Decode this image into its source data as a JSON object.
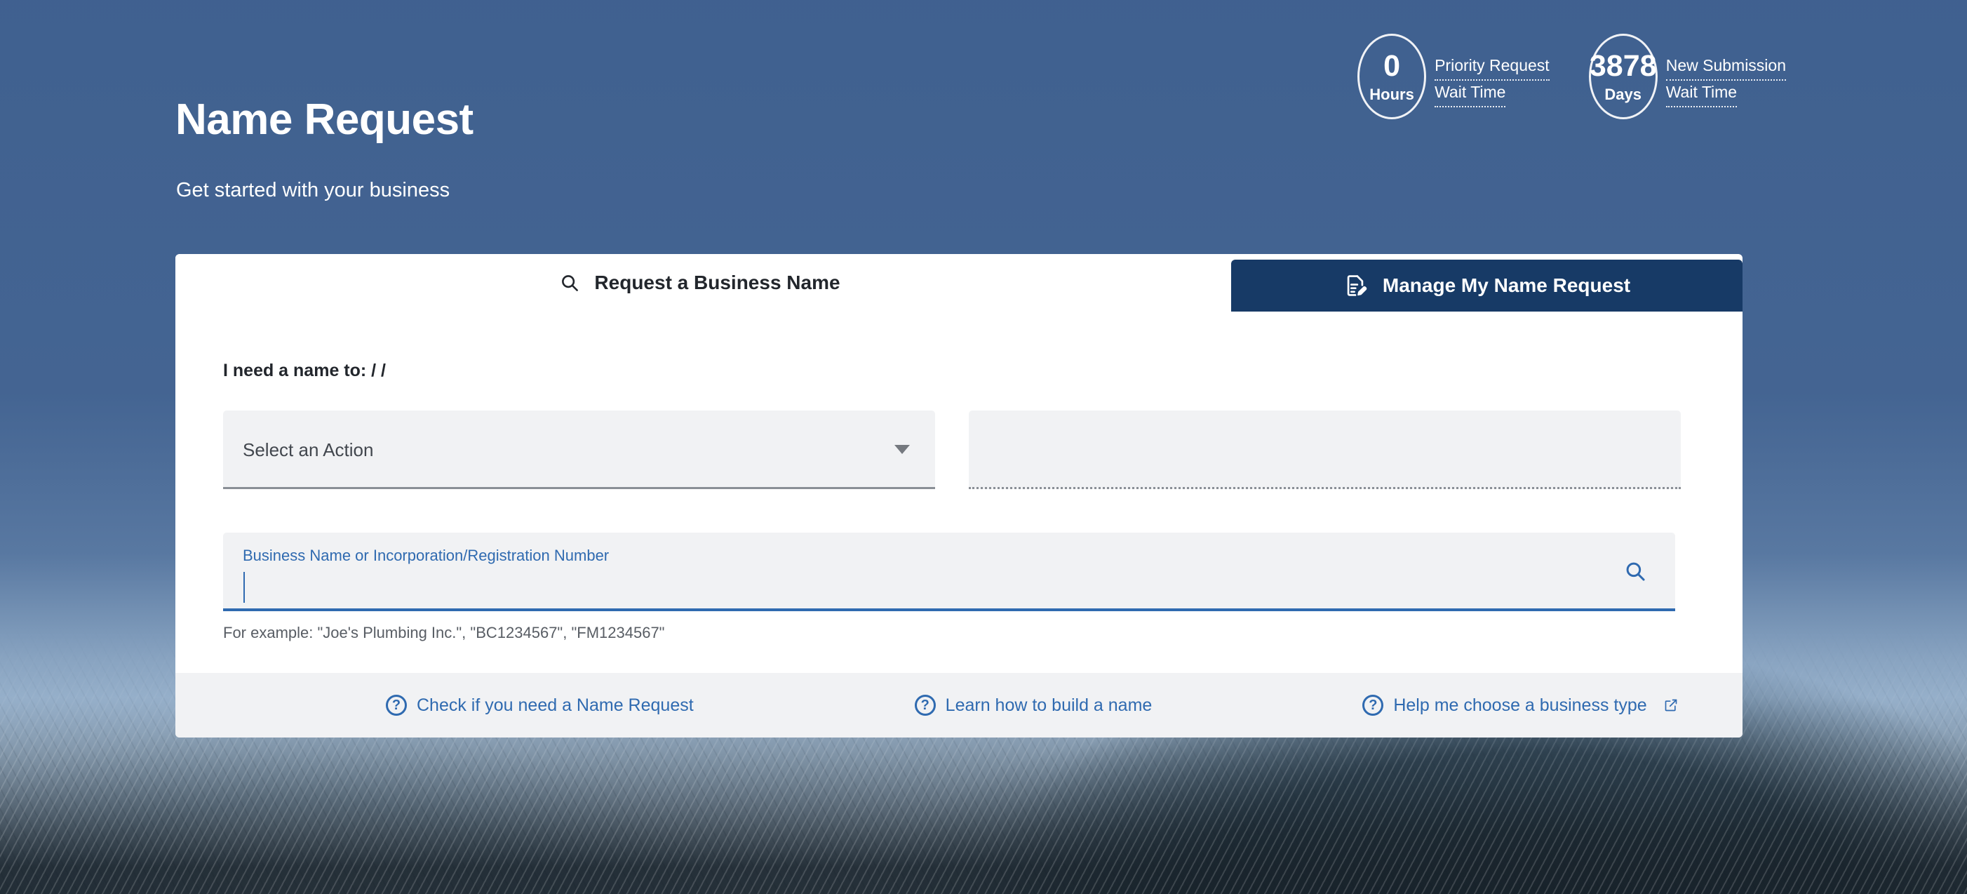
{
  "header": {
    "title": "Name Request",
    "subtitle": "Get started with your business"
  },
  "stats": [
    {
      "value": "0",
      "unit": "Hours",
      "label_line1": "Priority Request",
      "label_line2": "Wait Time",
      "icon": "oval-badge-icon"
    },
    {
      "value": "3878",
      "unit": "Days",
      "label_line1": "New Submission",
      "label_line2": "Wait Time",
      "icon": "oval-badge-icon"
    }
  ],
  "tabs": [
    {
      "label": "Request a Business Name",
      "icon": "search-icon",
      "active": true
    },
    {
      "label": "Manage My Name Request",
      "icon": "document-edit-icon",
      "active": false
    }
  ],
  "form": {
    "need_label": "I need a name to: / /",
    "action_select": {
      "value": "Select an Action",
      "caret": "chevron-down-icon"
    },
    "entity_select": {
      "value": ""
    },
    "search": {
      "float_label": "Business Name or Incorporation/Registration Number",
      "value": "",
      "placeholder": "",
      "icon": "search-icon",
      "hint": "For example: \"Joe's Plumbing Inc.\", \"BC1234567\", \"FM1234567\""
    }
  },
  "footer_links": [
    {
      "label": "Check if you need a Name Request",
      "icon": "question-circle-icon",
      "external": false
    },
    {
      "label": "Learn how to build a name",
      "icon": "question-circle-icon",
      "external": false
    },
    {
      "label": "Help me choose a business type",
      "icon": "question-circle-icon",
      "external": true
    }
  ],
  "colors": {
    "brand_navy": "#173a66",
    "brand_blue": "#2f6ab0",
    "overlay_blue": "#3b5c8c",
    "field_grey": "#f1f2f4",
    "text_dark": "#22262c"
  }
}
